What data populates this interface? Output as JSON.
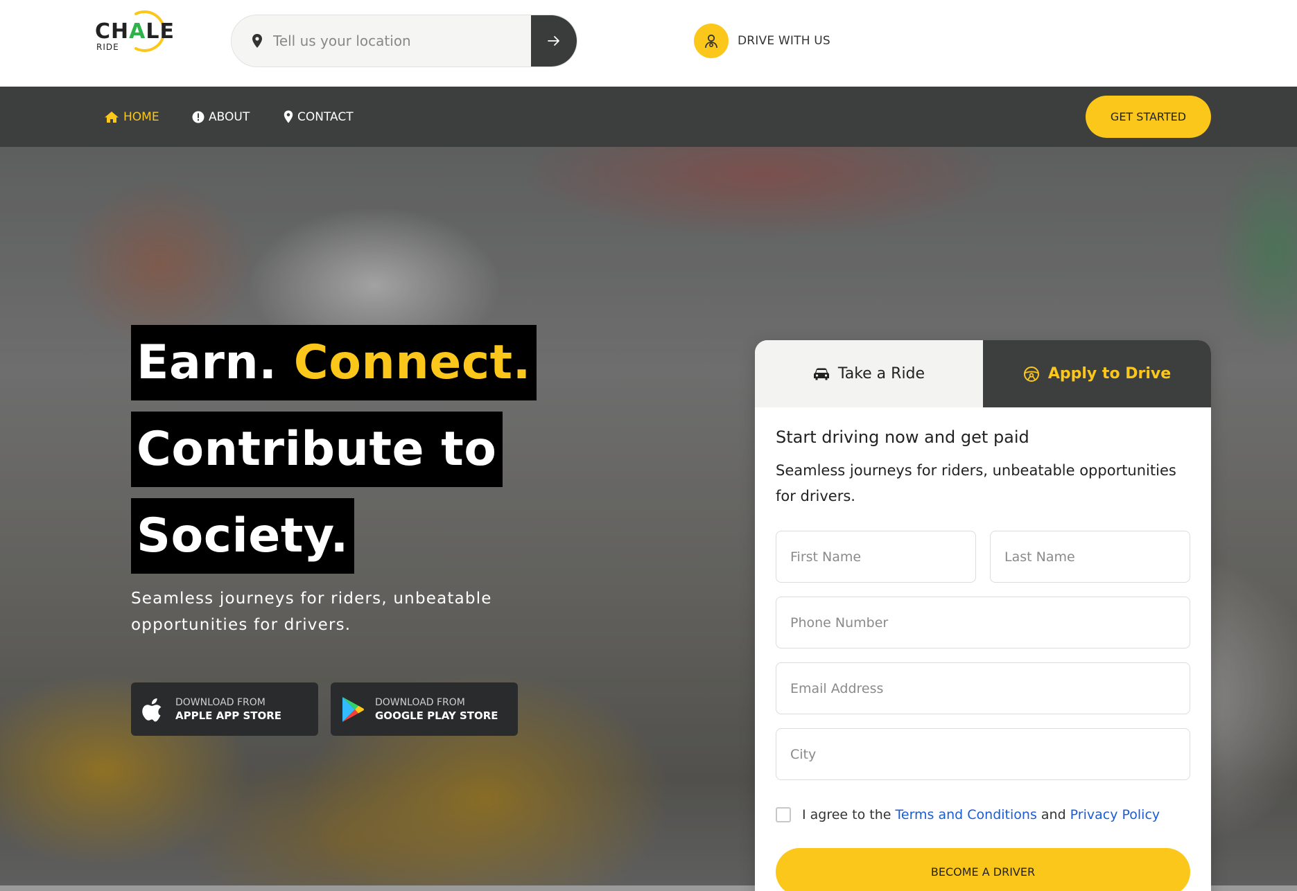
{
  "brand": {
    "logo_main_left": "CH",
    "logo_main_accent": "A",
    "logo_main_right": "LE",
    "logo_sub": "RIDE"
  },
  "location_search": {
    "placeholder": "Tell us your location",
    "value": ""
  },
  "drive_with_us": {
    "label": "DRIVE WITH US"
  },
  "nav": {
    "home": "HOME",
    "about": "ABOUT",
    "contact": "CONTACT",
    "cta": "GET STARTED"
  },
  "hero": {
    "line1_a": "Earn. ",
    "line1_b": "Connect.",
    "line2": "Contribute to",
    "line3": "Society.",
    "subtitle": "Seamless journeys for riders, unbeatable opportunities for drivers."
  },
  "stores": {
    "apple": {
      "small": "DOWNLOAD FROM",
      "big": "APPLE APP STORE"
    },
    "google": {
      "small": "DOWNLOAD FROM",
      "big": "GOOGLE PLAY STORE"
    }
  },
  "form": {
    "tabs": {
      "ride": "Take a Ride",
      "drive": "Apply to Drive"
    },
    "active_tab": "drive",
    "title": "Start driving now and get paid",
    "subtitle": "Seamless journeys for riders, unbeatable opportunities for drivers.",
    "fields": {
      "first_name": "First Name",
      "last_name": "Last Name",
      "phone": "Phone Number",
      "email": "Email Address",
      "city": "City"
    },
    "agree": {
      "prefix": "I agree to the ",
      "terms": "Terms and Conditions",
      "middle": " and ",
      "privacy": "Privacy Policy",
      "checked": false
    },
    "submit": "BECOME A DRIVER"
  },
  "colors": {
    "accent": "#fcc71b",
    "dark": "#3d3e3e",
    "link": "#1a5bd6",
    "logo_green": "#2db34a"
  }
}
